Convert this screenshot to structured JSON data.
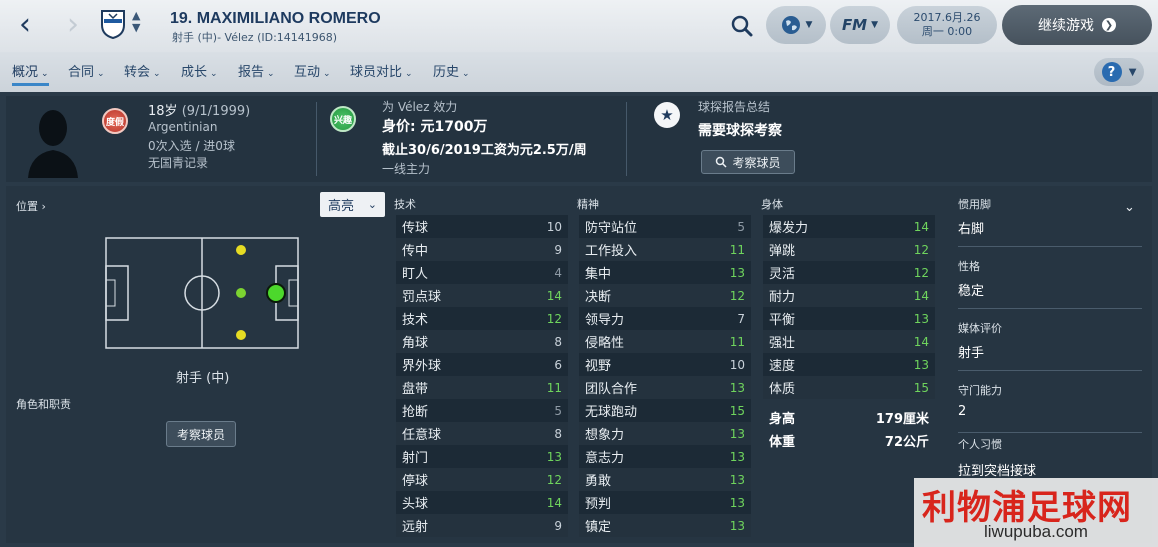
{
  "header": {
    "player_name": "19. MAXIMILIANO ROMERO",
    "player_sub": "射手 (中)- Vélez (ID:14141968)",
    "date_line1": "2017.6月.26",
    "date_line2": "周一 0:00",
    "fm_label": "FM",
    "continue_label": "继续游戏"
  },
  "tabs": [
    {
      "label": "概况"
    },
    {
      "label": "合同"
    },
    {
      "label": "转会"
    },
    {
      "label": "成长"
    },
    {
      "label": "报告"
    },
    {
      "label": "互动"
    },
    {
      "label": "球员对比"
    },
    {
      "label": "历史"
    }
  ],
  "help_label": "?",
  "info": {
    "badge_red": "度假",
    "age": "18岁",
    "birth": "(9/1/1999)",
    "nationality": "Argentinian",
    "caps": "0次入选 / 进0球",
    "youth": "无国青记录",
    "badge_green": "兴趣",
    "club_line": "为 Vélez 效力",
    "value": "身价: 元1700万",
    "contract": "截止30/6/2019工资为元2.5万/周",
    "squad_status": "一线主力",
    "scout_title": "球探报告总结",
    "scout_text": "需要球探考察",
    "scout_button": "考察球员"
  },
  "position_panel": {
    "label": "位置",
    "highlight": "高亮",
    "position_name": "射手 (中)",
    "role_label": "角色和职责",
    "scout_button": "考察球员"
  },
  "attributes": {
    "technical_title": "技术",
    "technical": [
      {
        "name": "传球",
        "value": "10",
        "color": "#c9d2da"
      },
      {
        "name": "传中",
        "value": "9",
        "color": "#c9d2da"
      },
      {
        "name": "盯人",
        "value": "4",
        "color": "#8e9aa5"
      },
      {
        "name": "罚点球",
        "value": "14",
        "color": "#6fd45d"
      },
      {
        "name": "技术",
        "value": "12",
        "color": "#6fd45d"
      },
      {
        "name": "角球",
        "value": "8",
        "color": "#c9d2da"
      },
      {
        "name": "界外球",
        "value": "6",
        "color": "#c9d2da"
      },
      {
        "name": "盘带",
        "value": "11",
        "color": "#6fd45d"
      },
      {
        "name": "抢断",
        "value": "5",
        "color": "#8e9aa5"
      },
      {
        "name": "任意球",
        "value": "8",
        "color": "#c9d2da"
      },
      {
        "name": "射门",
        "value": "13",
        "color": "#6fd45d"
      },
      {
        "name": "停球",
        "value": "12",
        "color": "#6fd45d"
      },
      {
        "name": "头球",
        "value": "14",
        "color": "#6fd45d"
      },
      {
        "name": "远射",
        "value": "9",
        "color": "#c9d2da"
      }
    ],
    "mental_title": "精神",
    "mental": [
      {
        "name": "防守站位",
        "value": "5",
        "color": "#8e9aa5"
      },
      {
        "name": "工作投入",
        "value": "11",
        "color": "#6fd45d"
      },
      {
        "name": "集中",
        "value": "13",
        "color": "#6fd45d"
      },
      {
        "name": "决断",
        "value": "12",
        "color": "#6fd45d"
      },
      {
        "name": "领导力",
        "value": "7",
        "color": "#c9d2da"
      },
      {
        "name": "侵略性",
        "value": "11",
        "color": "#6fd45d"
      },
      {
        "name": "视野",
        "value": "10",
        "color": "#c9d2da"
      },
      {
        "name": "团队合作",
        "value": "13",
        "color": "#6fd45d"
      },
      {
        "name": "无球跑动",
        "value": "15",
        "color": "#6fd45d"
      },
      {
        "name": "想象力",
        "value": "13",
        "color": "#6fd45d"
      },
      {
        "name": "意志力",
        "value": "13",
        "color": "#6fd45d"
      },
      {
        "name": "勇敢",
        "value": "13",
        "color": "#6fd45d"
      },
      {
        "name": "预判",
        "value": "13",
        "color": "#6fd45d"
      },
      {
        "name": "镇定",
        "value": "13",
        "color": "#6fd45d"
      }
    ],
    "physical_title": "身体",
    "physical": [
      {
        "name": "爆发力",
        "value": "14",
        "color": "#6fd45d"
      },
      {
        "name": "弹跳",
        "value": "12",
        "color": "#6fd45d"
      },
      {
        "name": "灵活",
        "value": "12",
        "color": "#6fd45d"
      },
      {
        "name": "耐力",
        "value": "14",
        "color": "#6fd45d"
      },
      {
        "name": "平衡",
        "value": "13",
        "color": "#6fd45d"
      },
      {
        "name": "强壮",
        "value": "14",
        "color": "#6fd45d"
      },
      {
        "name": "速度",
        "value": "13",
        "color": "#6fd45d"
      },
      {
        "name": "体质",
        "value": "15",
        "color": "#6fd45d"
      }
    ],
    "height_label": "身高",
    "height_value": "179厘米",
    "weight_label": "体重",
    "weight_value": "72公斤"
  },
  "right_panel": {
    "foot_label": "惯用脚",
    "foot_value": "右脚",
    "personality_label": "性格",
    "personality_value": "稳定",
    "media_label": "媒体评价",
    "media_value": "射手",
    "keeping_label": "守门能力",
    "keeping_value": "2",
    "habits_label": "个人习惯",
    "habits_value": "拉到突档接球"
  },
  "watermark": {
    "cn": "利物浦足球网",
    "en": "liwupuba.com"
  }
}
